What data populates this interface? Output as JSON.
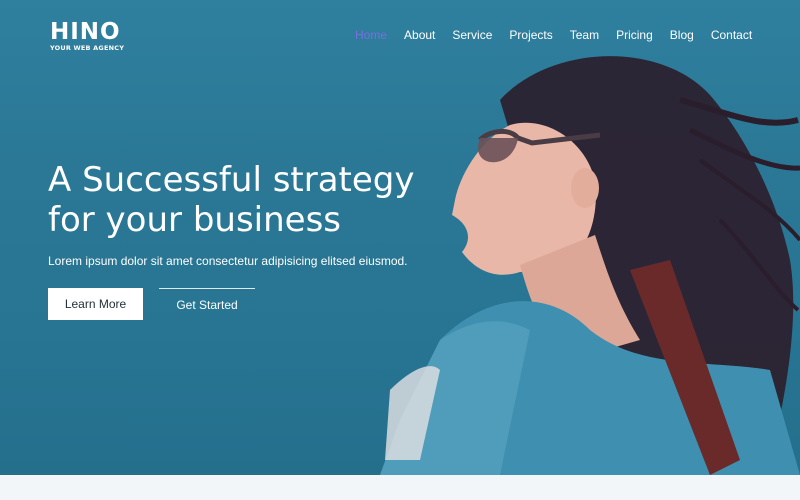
{
  "brand": {
    "name": "HINO",
    "tagline": "YOUR WEB AGENCY"
  },
  "nav": {
    "items": [
      {
        "label": "Home",
        "active": true
      },
      {
        "label": "About"
      },
      {
        "label": "Service"
      },
      {
        "label": "Projects"
      },
      {
        "label": "Team"
      },
      {
        "label": "Pricing"
      },
      {
        "label": "Blog"
      },
      {
        "label": "Contact"
      }
    ]
  },
  "hero": {
    "headline_line1": "A Successful strategy",
    "headline_line2": "for your business",
    "subtext": "Lorem ipsum dolor sit amet consectetur adipisicing elitsed eiusmod.",
    "primary_button": "Learn More",
    "secondary_button": "Get Started"
  },
  "colors": {
    "accent_active_nav": "#7a6fdf",
    "hero_background": "#2a7895",
    "button_background": "#ffffff"
  }
}
